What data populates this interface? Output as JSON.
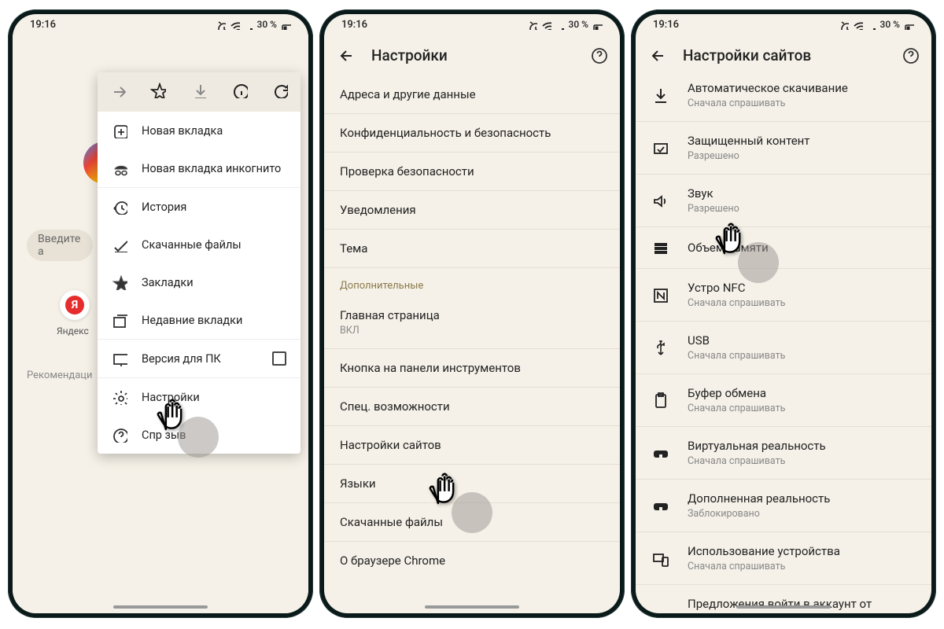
{
  "status": {
    "time": "19:16",
    "battery": "30 %"
  },
  "phone1": {
    "search_placeholder": "Введите а",
    "yandex_label": "Яндекс",
    "reco_label": "Рекомендаци",
    "menu": {
      "new_tab": "Новая вкладка",
      "incognito": "Новая вкладка инкогнито",
      "history": "История",
      "downloads": "Скачанные файлы",
      "bookmarks": "Закладки",
      "recent_tabs": "Недавние вкладки",
      "desktop_site": "Версия для ПК",
      "settings": "Настройки",
      "help": "Спр               зыв"
    }
  },
  "phone2": {
    "title": "Настройки",
    "items": [
      "Адреса и другие данные",
      "Конфиденциальность и безопасность",
      "Проверка безопасности",
      "Уведомления",
      "Тема"
    ],
    "section": "Дополнительные",
    "home": {
      "title": "Главная страница",
      "sub": "ВКЛ"
    },
    "items2": [
      "Кнопка на панели инструментов",
      "Спец. возможности",
      "Настройки сайтов",
      "Языки",
      "Скачанные файлы",
      "О браузере Chrome"
    ]
  },
  "phone3": {
    "title": "Настройки сайтов",
    "items": [
      {
        "title": "Автоматическое скачивание",
        "sub": "Сначала спрашивать",
        "icon": "download"
      },
      {
        "title": "Защищенный контент",
        "sub": "Разрешено",
        "icon": "protected"
      },
      {
        "title": "Звук",
        "sub": "Разрешено",
        "icon": "sound"
      },
      {
        "title": "Объем памяти",
        "sub": "",
        "icon": "storage"
      },
      {
        "title": "Устро           NFC",
        "sub": "Сначала спрашивать",
        "icon": "nfc"
      },
      {
        "title": "USB",
        "sub": "Сначала спрашивать",
        "icon": "usb"
      },
      {
        "title": "Буфер обмена",
        "sub": "Сначала спрашивать",
        "icon": "clipboard"
      },
      {
        "title": "Виртуальная реальность",
        "sub": "Сначала спрашивать",
        "icon": "vr"
      },
      {
        "title": "Дополненная реальность",
        "sub": "Заблокировано",
        "icon": "ar"
      },
      {
        "title": "Использование устройства",
        "sub": "Сначала спрашивать",
        "icon": "device"
      },
      {
        "title": "Предложения войти в аккаунт от",
        "sub": "",
        "icon": ""
      }
    ]
  }
}
